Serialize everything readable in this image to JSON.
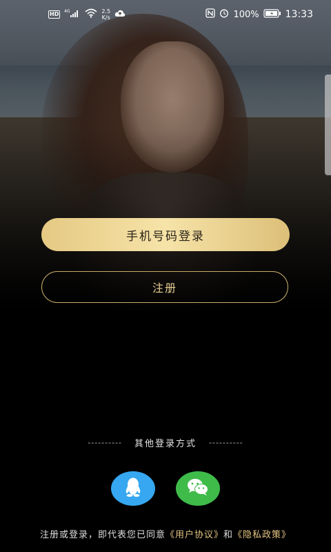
{
  "status_bar": {
    "hd": "HD",
    "network": "4G",
    "speed_value": "2.5",
    "speed_unit": "K/s",
    "battery": "100%",
    "time": "13:33"
  },
  "login": {
    "phone_login_label": "手机号码登录",
    "register_label": "注册"
  },
  "other_login": {
    "dashes_left": "----------",
    "title": "其他登录方式",
    "dashes_right": "----------",
    "providers": [
      "qq-icon",
      "wechat-icon"
    ]
  },
  "agreement": {
    "prefix": "注册或登录，即代表您已同意",
    "user_agreement": "《用户协议》",
    "and": "和",
    "privacy_policy": "《隐私政策》"
  },
  "colors": {
    "gold_gradient_start": "#e5c983",
    "gold_gradient_end": "#f6e3a8",
    "gold_text": "#e4c583",
    "qq_blue": "#36a7f0",
    "wechat_green": "#3fbb4a",
    "background": "#000000"
  }
}
